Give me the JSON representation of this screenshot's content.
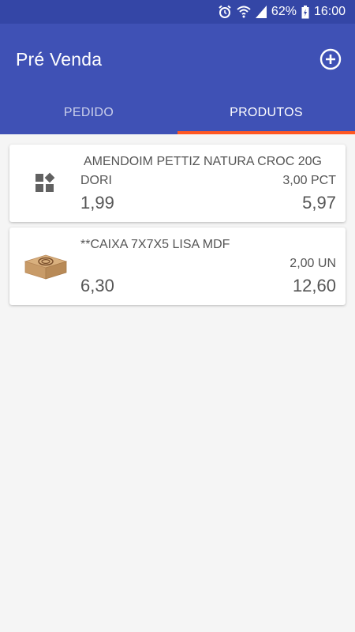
{
  "status_bar": {
    "battery": "62%",
    "time": "16:00",
    "icons": [
      "alarm-icon",
      "wifi-icon",
      "signal-icon",
      "battery-icon"
    ]
  },
  "app_bar": {
    "title": "Pré Venda",
    "add_icon": "add-circle-icon",
    "background": "#3f51b5",
    "indicator_color": "#ff5722"
  },
  "tabs": [
    {
      "label": "PEDIDO",
      "active": false
    },
    {
      "label": "PRODUTOS",
      "active": true
    }
  ],
  "products": [
    {
      "name": "AMENDOIM PETTIZ NATURA CROC 20G",
      "brand": "DORI",
      "quantity": "3,00 PCT",
      "unit_price": "1,99",
      "total": "5,97",
      "image": "placeholder-widgets-icon"
    },
    {
      "name": "**CAIXA 7X7X5 LISA MDF",
      "brand": "",
      "quantity": "2,00 UN",
      "unit_price": "6,30",
      "total": "12,60",
      "image": "wooden-box-image"
    }
  ]
}
